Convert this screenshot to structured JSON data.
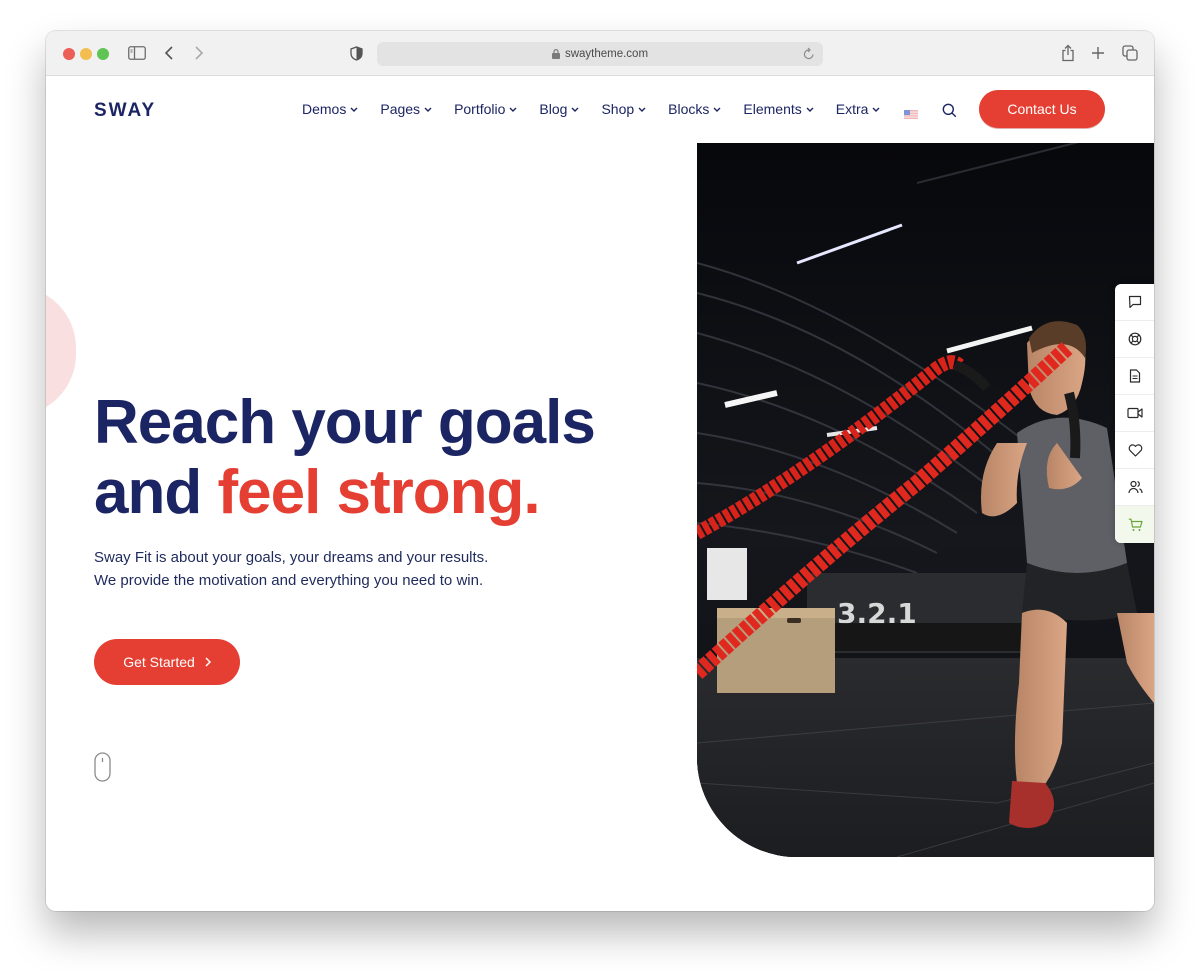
{
  "browser": {
    "url": "swaytheme.com",
    "icons": [
      "sidebar-toggle-icon",
      "back-icon",
      "forward-icon",
      "privacy-shield-icon",
      "lock-icon",
      "reload-icon",
      "share-icon",
      "new-tab-icon",
      "tab-overview-icon"
    ]
  },
  "header": {
    "logo": "SWAY",
    "nav": [
      {
        "label": "Demos"
      },
      {
        "label": "Pages"
      },
      {
        "label": "Portfolio"
      },
      {
        "label": "Blog"
      },
      {
        "label": "Shop"
      },
      {
        "label": "Blocks"
      },
      {
        "label": "Elements"
      },
      {
        "label": "Extra"
      }
    ],
    "language_icon": "us-flag-icon",
    "search_icon": "search-icon",
    "contact_label": "Contact Us"
  },
  "hero": {
    "headline_line1": "Reach your goals",
    "headline_line2_part1": "and ",
    "headline_line2_accent": "feel strong.",
    "subtext_line1": "Sway Fit is about your goals, your dreams and your results.",
    "subtext_line2": "We provide the motivation and everything you need to win.",
    "cta_label": "Get Started",
    "image_description": "Man exercising with red battle ropes in a dark gym"
  },
  "side_toolbar": [
    {
      "icon": "chat-icon"
    },
    {
      "icon": "support-lifebuoy-icon"
    },
    {
      "icon": "document-icon"
    },
    {
      "icon": "video-icon"
    },
    {
      "icon": "heart-icon"
    },
    {
      "icon": "users-icon"
    },
    {
      "icon": "cart-icon"
    }
  ],
  "colors": {
    "brand_navy": "#1c2564",
    "accent_red": "#e53e32",
    "cart_green": "#6aa53b"
  }
}
